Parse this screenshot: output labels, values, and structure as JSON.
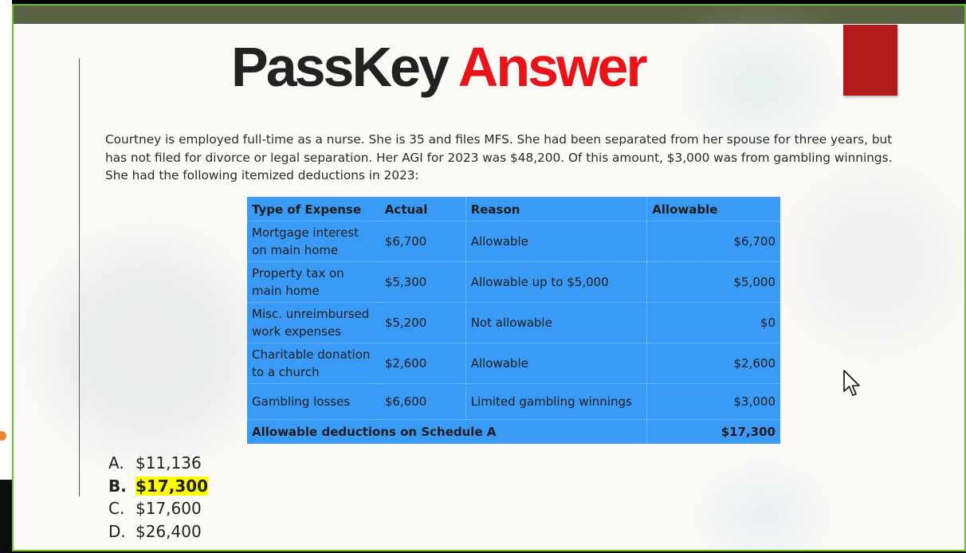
{
  "slide": {
    "title_part1": "PassKey",
    "title_part2": "Answer",
    "question": "Courtney is employed full-time as a nurse. She is 35 and files MFS. She had been separated from her spouse for three years, but has not filed for divorce or legal separation. Her AGI for 2023 was $48,200. Of this amount, $3,000 was from gambling winnings. She had the following itemized deductions in 2023:",
    "table": {
      "headers": [
        "Type of Expense",
        "Actual",
        "Reason",
        "Allowable"
      ],
      "rows": [
        {
          "type": "Mortgage interest on main home",
          "actual": "$6,700",
          "reason": "Allowable",
          "allowable": "$6,700"
        },
        {
          "type": "Property tax on main home",
          "actual": "$5,300",
          "reason": "Allowable up to $5,000",
          "allowable": "$5,000"
        },
        {
          "type": "Misc. unreimbursed work expenses",
          "actual": "$5,200",
          "reason": "Not allowable",
          "allowable": "$0"
        },
        {
          "type": "Charitable donation to a church",
          "actual": "$2,600",
          "reason": "Allowable",
          "allowable": "$2,600"
        },
        {
          "type": "Gambling losses",
          "actual": "$6,600",
          "reason": "Limited gambling winnings",
          "allowable": "$3,000"
        }
      ],
      "total_label": "Allowable deductions on Schedule A",
      "total_value": "$17,300"
    },
    "choices": [
      {
        "letter": "A.",
        "amount": "$11,136",
        "correct": false
      },
      {
        "letter": "B.",
        "amount": "$17,300",
        "correct": true
      },
      {
        "letter": "C.",
        "amount": "$17,600",
        "correct": false
      },
      {
        "letter": "D.",
        "amount": "$26,400",
        "correct": false
      }
    ]
  },
  "colors": {
    "frame_border": "#5fc12c",
    "top_bar": "#5b6347",
    "title_accent": "#e8141a",
    "table_bg": "#3a9bf6",
    "highlight": "#ffff00",
    "red_block": "#b01a1a"
  },
  "icons": {
    "cursor": "mouse-pointer-icon"
  }
}
